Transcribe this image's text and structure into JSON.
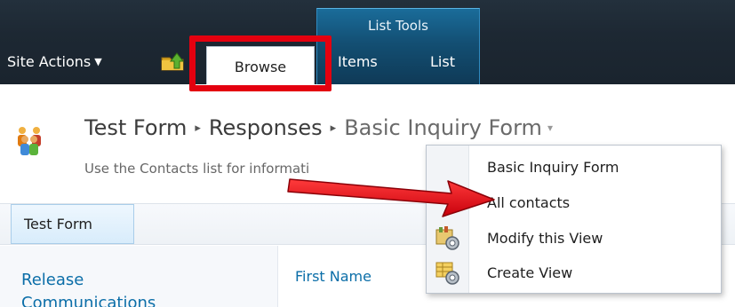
{
  "ribbon": {
    "site_actions": "Site Actions",
    "site_actions_caret": "▼",
    "browse_tab": "Browse",
    "contextual_group": "List Tools",
    "items_tab": "Items",
    "list_tab": "List"
  },
  "title_area": {
    "breadcrumb": [
      "Test Form",
      "Responses",
      "Basic Inquiry Form"
    ],
    "separator": "▸",
    "dropdown_caret": "▾",
    "description": "Use the Contacts list for informati"
  },
  "top_nav": {
    "current_site": "Test Form"
  },
  "quick_launch": {
    "first_link": "Release Communications"
  },
  "list_view": {
    "first_column": "First Name"
  },
  "view_menu": {
    "items": [
      {
        "label": "Basic Inquiry Form",
        "icon": ""
      },
      {
        "label": "All contacts",
        "icon": ""
      },
      {
        "label": "Modify this View",
        "icon": "modify-view-icon"
      },
      {
        "label": "Create View",
        "icon": "create-view-icon"
      }
    ]
  },
  "annotations": {
    "highlight_color": "#e4000f",
    "arrow_color": "#e4000f"
  },
  "colors": {
    "ribbon_bg": "#1d2833",
    "contextual_tab_bg": "#134f73",
    "link": "#0b6ea8"
  }
}
